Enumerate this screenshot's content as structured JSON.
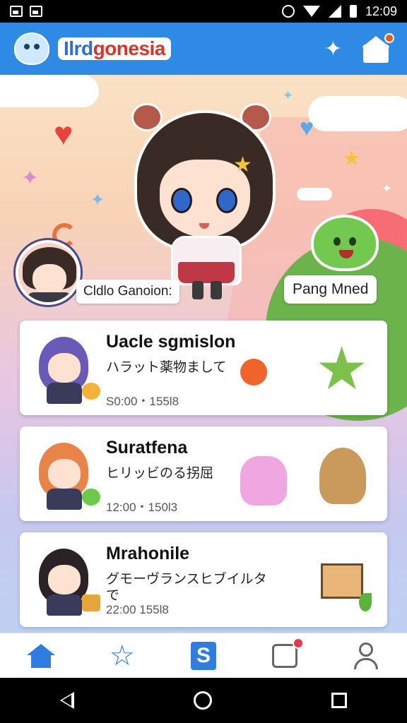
{
  "status_bar": {
    "time": "12:09",
    "left_icons": [
      "image-notification-icon",
      "gallery-notification-icon"
    ],
    "right_icons": [
      "alarm-icon",
      "wifi-icon",
      "signal-icon",
      "battery-icon"
    ]
  },
  "app_bar": {
    "title_prefix": "Ilrd",
    "title_main": "gonesia",
    "logo": "mascot-logo-icon",
    "actions": [
      "sparkle-star-icon",
      "home-notification-icon"
    ],
    "accent": "#2f8ae6"
  },
  "hero": {
    "left_label": "Cldlo Ganoion:",
    "right_label": "Pang Mned"
  },
  "cards": [
    {
      "title": "Uacle sgmislon",
      "subtitle": "ハラット薬物まして",
      "meta": "S0:00・155l8",
      "hair_color": "#6a5ab8"
    },
    {
      "title": "Suratfena",
      "subtitle": "ヒリッビのる拐屈",
      "meta": "12:00・150l3",
      "hair_color": "#e8844a"
    },
    {
      "title": "Mrahonile",
      "subtitle": "グモーヴランスヒブイルタ で",
      "meta": "22:00 155l8",
      "hair_color": "#2a2226"
    }
  ],
  "bottom_nav": {
    "items": [
      "home-icon",
      "star-icon",
      "s-icon",
      "box-notification-icon",
      "profile-icon"
    ],
    "active": "home-icon"
  },
  "system_nav": [
    "back-icon",
    "home-circle-icon",
    "recent-apps-icon"
  ]
}
